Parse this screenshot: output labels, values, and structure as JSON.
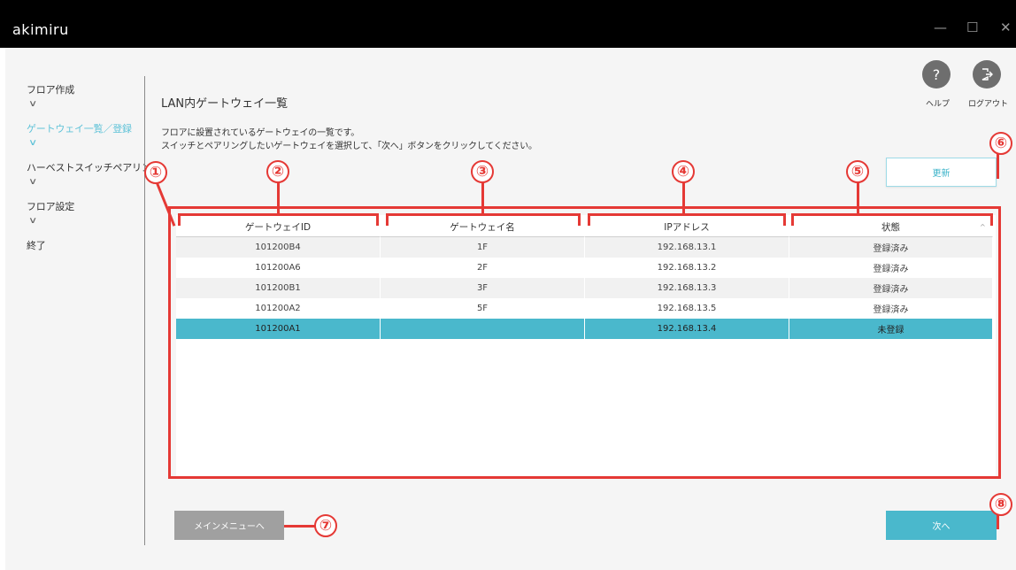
{
  "window": {
    "app_title": "akimiru",
    "controls": {
      "minimize": "—",
      "maximize": "☐",
      "close": "✕"
    }
  },
  "sidebar": {
    "items": [
      {
        "label": "フロア作成",
        "active": false,
        "expandable": true
      },
      {
        "label": "ゲートウェイ一覧／登録",
        "active": true,
        "expandable": true
      },
      {
        "label": "ハーベストスイッチペアリング",
        "active": false,
        "expandable": true
      },
      {
        "label": "フロア設定",
        "active": false,
        "expandable": true
      },
      {
        "label": "終了",
        "active": false,
        "expandable": false
      }
    ],
    "chevron": "∨"
  },
  "header": {
    "help_icon": "?",
    "help_label": "ヘルプ",
    "logout_label": "ログアウト"
  },
  "main": {
    "title": "LAN内ゲートウェイ一覧",
    "description_line1": "フロアに設置されているゲートウェイの一覧です。",
    "description_line2": "スイッチとペアリングしたいゲートウェイを選択して、「次へ」ボタンをクリックしてください。",
    "update_button": "更新",
    "table": {
      "columns": [
        "ゲートウェイID",
        "ゲートウェイ名",
        "IPアドレス",
        "状態"
      ],
      "sort_indicator": "^",
      "rows": [
        {
          "id": "101200B4",
          "name": "1F",
          "ip": "192.168.13.1",
          "status": "登録済み",
          "selected": false
        },
        {
          "id": "101200A6",
          "name": "2F",
          "ip": "192.168.13.2",
          "status": "登録済み",
          "selected": false
        },
        {
          "id": "101200B1",
          "name": "3F",
          "ip": "192.168.13.3",
          "status": "登録済み",
          "selected": false
        },
        {
          "id": "101200A2",
          "name": "5F",
          "ip": "192.168.13.5",
          "status": "登録済み",
          "selected": false
        },
        {
          "id": "101200A1",
          "name": "",
          "ip": "192.168.13.4",
          "status": "未登録",
          "selected": true
        }
      ]
    },
    "main_menu_button": "メインメニューへ",
    "next_button": "次へ"
  },
  "annotations": [
    "①",
    "②",
    "③",
    "④",
    "⑤",
    "⑥",
    "⑦",
    "⑧"
  ],
  "colors": {
    "accent": "#4ab8cc",
    "sidebar_active": "#5ec2d8",
    "annotation_red": "#e53935",
    "titlebar": "#000000"
  }
}
